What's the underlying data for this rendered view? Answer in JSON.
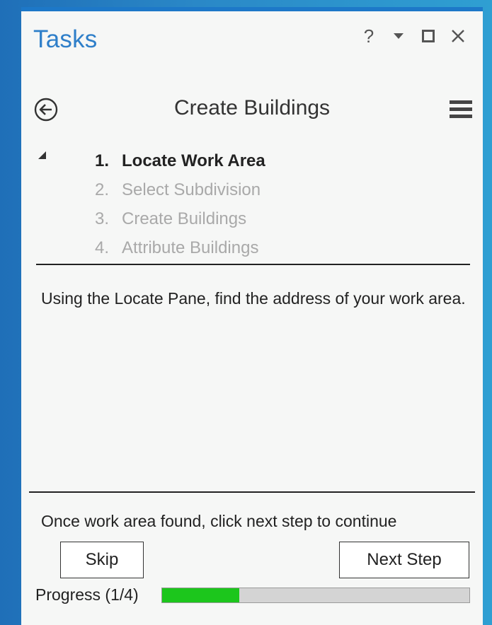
{
  "pane": {
    "title": "Tasks",
    "controls": {
      "help": "?",
      "dropdown_icon": "chevron-down-icon",
      "maximize_icon": "maximize-icon",
      "close_icon": "close-icon"
    }
  },
  "task": {
    "back_icon": "back-arrow-circle-icon",
    "heading": "Create Buildings",
    "menu_icon": "hamburger-menu-icon",
    "collapse_icon": "collapse-triangle-icon",
    "steps": [
      {
        "number": "1.",
        "label": "Locate Work Area",
        "active": true
      },
      {
        "number": "2.",
        "label": "Select Subdivision",
        "active": false
      },
      {
        "number": "3.",
        "label": "Create Buildings",
        "active": false
      },
      {
        "number": "4.",
        "label": "Attribute Buildings",
        "active": false
      }
    ],
    "instructions": "Using the Locate Pane, find the address of your work area.",
    "hint": "Once work area found, click next step to continue"
  },
  "buttons": {
    "skip": "Skip",
    "next_step": "Next Step"
  },
  "progress": {
    "label": "Progress (1/4)",
    "fraction": 0.25,
    "fill_color": "#1cc61c",
    "track_color": "#d4d4d4"
  },
  "colors": {
    "accent": "#1d78c8",
    "title": "#2f7fc9",
    "inactive_step": "#a9a9a9"
  }
}
